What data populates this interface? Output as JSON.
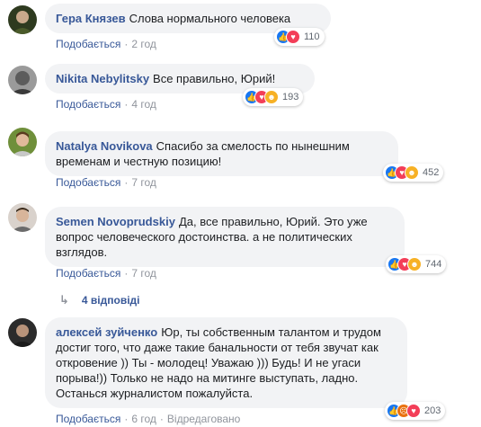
{
  "comments": [
    {
      "author": "Гера Князев",
      "text": "Слова нормального человека",
      "reactions": [
        "like",
        "love"
      ],
      "reaction_count": "110",
      "like_label": "Подобається",
      "time": "2 год"
    },
    {
      "author": "Nikita Nebylitsky",
      "text": "Все правильно, Юрий!",
      "reactions": [
        "like",
        "love",
        "haha"
      ],
      "reaction_count": "193",
      "like_label": "Подобається",
      "time": "4 год"
    },
    {
      "author": "Natalya Novikova",
      "text": "Спасибо за смелость по нынешним временам и честную позицию!",
      "reactions": [
        "like",
        "love",
        "haha"
      ],
      "reaction_count": "452",
      "like_label": "Подобається",
      "time": "7 год"
    },
    {
      "author": "Semen Novoprudskiy",
      "text": "Да, все правильно, Юрий. Это уже вопрос человеческого достоинства. а не политических взглядов.",
      "reactions": [
        "like",
        "love",
        "haha"
      ],
      "reaction_count": "744",
      "like_label": "Подобається",
      "time": "7 год",
      "replies_label": "4 відповіді"
    },
    {
      "author": "алексей зуйченко",
      "text": "Юр, ты собственным талантом и трудом достиг того, что даже такие банальности от тебя звучат как откровение )) Ты - молодец! Уважаю ))) Будь! И не угаси порыва!)) Только не надо на митинге выступать, ладно. Останься журналистом пожалуйста.",
      "reactions": [
        "like",
        "angry",
        "love"
      ],
      "reaction_count": "203",
      "like_label": "Подобається",
      "time": "6 год",
      "edited_label": "Відредаговано"
    }
  ]
}
